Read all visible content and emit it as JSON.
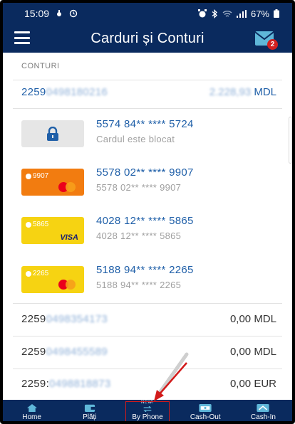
{
  "status": {
    "time": "15:09",
    "battery": "67%"
  },
  "header": {
    "title": "Carduri și Conturi",
    "mail_badge": "2"
  },
  "section_label": "CONTURI",
  "accounts_top": {
    "number": "2259",
    "number_hidden": "0498180216",
    "amount_hidden": "2.228,93",
    "currency": "MDL"
  },
  "cards": [
    {
      "number": "5574 84** **** 5724",
      "sub": "Cardul este blocat",
      "style": "locked"
    },
    {
      "number": "5578 02** **** 9907",
      "sub": "5578 02** **** 9907",
      "style": "mastercard-orange",
      "mini": "9907"
    },
    {
      "number": "4028 12** **** 5865",
      "sub": "4028 12** **** 5865",
      "style": "visa-yellow",
      "mini": "5865",
      "brand": "VISA"
    },
    {
      "number": "5188 94** **** 2265",
      "sub": "5188 94** **** 2265",
      "style": "mastercard-yellow",
      "mini": "2265"
    }
  ],
  "accounts_bottom": [
    {
      "prefix": "2259",
      "hidden": "0498354173",
      "amount": "0,00 MDL"
    },
    {
      "prefix": "2259",
      "hidden": "0498455589",
      "amount": "0,00 MDL"
    },
    {
      "prefix": "2259:",
      "hidden": "0498818873",
      "amount": "0,00 EUR"
    }
  ],
  "nav": [
    {
      "label": "Home",
      "icon": "home-icon"
    },
    {
      "label": "Plăți",
      "icon": "wallet-icon"
    },
    {
      "label": "By Phone",
      "icon": "transfer-icon",
      "badge": "NEW!"
    },
    {
      "label": "Cash-Out",
      "icon": "cash-out-icon"
    },
    {
      "label": "Cash-In",
      "icon": "cash-in-icon"
    }
  ],
  "colors": {
    "brand_dark": "#0a2a5e",
    "link_blue": "#1f5fa8",
    "mastercard_red": "#eb001b",
    "mastercard_orange": "#f79e1b",
    "annotation_red": "#d21a1a"
  }
}
